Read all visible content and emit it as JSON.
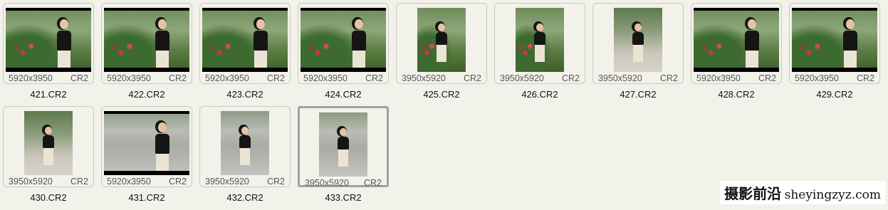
{
  "files": [
    {
      "name": "421.CR2",
      "dims": "5920x3950",
      "ext": "CR2",
      "orientation": "landscape",
      "scene": "garden",
      "selected": false
    },
    {
      "name": "422.CR2",
      "dims": "5920x3950",
      "ext": "CR2",
      "orientation": "landscape",
      "scene": "garden",
      "selected": false
    },
    {
      "name": "423.CR2",
      "dims": "5920x3950",
      "ext": "CR2",
      "orientation": "landscape",
      "scene": "garden",
      "selected": false
    },
    {
      "name": "424.CR2",
      "dims": "5920x3950",
      "ext": "CR2",
      "orientation": "landscape",
      "scene": "garden",
      "selected": false
    },
    {
      "name": "425.CR2",
      "dims": "3950x5920",
      "ext": "CR2",
      "orientation": "portrait",
      "scene": "garden",
      "selected": false
    },
    {
      "name": "426.CR2",
      "dims": "3950x5920",
      "ext": "CR2",
      "orientation": "portrait",
      "scene": "garden",
      "selected": false
    },
    {
      "name": "427.CR2",
      "dims": "3950x5920",
      "ext": "CR2",
      "orientation": "portrait",
      "scene": "pavement",
      "selected": false
    },
    {
      "name": "428.CR2",
      "dims": "5920x3950",
      "ext": "CR2",
      "orientation": "landscape",
      "scene": "garden",
      "selected": false
    },
    {
      "name": "429.CR2",
      "dims": "5920x3950",
      "ext": "CR2",
      "orientation": "landscape",
      "scene": "garden",
      "selected": false
    },
    {
      "name": "430.CR2",
      "dims": "3950x5920",
      "ext": "CR2",
      "orientation": "portrait",
      "scene": "pavement",
      "selected": false
    },
    {
      "name": "431.CR2",
      "dims": "5920x3950",
      "ext": "CR2",
      "orientation": "landscape",
      "scene": "street",
      "selected": false
    },
    {
      "name": "432.CR2",
      "dims": "3950x5920",
      "ext": "CR2",
      "orientation": "portrait",
      "scene": "street",
      "selected": false
    },
    {
      "name": "433.CR2",
      "dims": "3950x5920",
      "ext": "CR2",
      "orientation": "portrait",
      "scene": "street",
      "selected": true
    }
  ],
  "watermark": {
    "cn": "摄影前沿",
    "url": "sheyingzyz.com"
  },
  "colors": {
    "background": "#f3f2ea",
    "selected_border": "#a0a0a0"
  }
}
